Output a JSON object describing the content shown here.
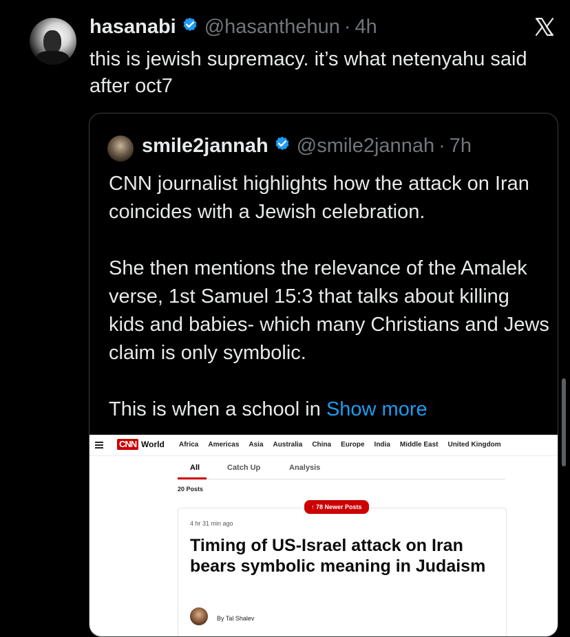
{
  "main_tweet": {
    "display_name": "hasanabi",
    "handle": "@hasanthehun",
    "separator": "·",
    "time": "4h",
    "text": "this is jewish supremacy. it’s what netenyahu said after oct7"
  },
  "quoted_tweet": {
    "display_name": "smile2jannah",
    "handle": "@smile2jannah",
    "separator": "·",
    "time": "7h",
    "paragraph_1": "CNN journalist highlights how the attack on Iran coincides with a Jewish celebration.",
    "paragraph_2": "She then mentions the relevance of the Amalek verse, 1st Samuel 15:3 that talks about killing kids and babies- which many Christians and Jews claim is only symbolic.",
    "paragraph_3": "This is when a school in ",
    "show_more": "Show more"
  },
  "cnn_screenshot": {
    "logo": "CNN",
    "section": "World",
    "nav_links": [
      "Africa",
      "Americas",
      "Asia",
      "Australia",
      "China",
      "Europe",
      "India",
      "Middle East",
      "United Kingdom"
    ],
    "tabs": [
      "All",
      "Catch Up",
      "Analysis"
    ],
    "post_count": "20 Posts",
    "newer_posts": "↑ 78 Newer Posts",
    "post_time": "4 hr 31 min ago",
    "headline": "Timing of US-Israel attack on Iran bears symbolic meaning in Judaism",
    "author": "By Tal Shalev"
  },
  "colors": {
    "background": "#000000",
    "text": "#e7e9ea",
    "secondary_text": "#71767b",
    "link": "#1d9bf0",
    "verified": "#1d9bf0",
    "cnn_red": "#cc0000"
  },
  "icons": {
    "verified": "verified-badge-icon",
    "x_logo": "x-logo-icon",
    "menu": "hamburger-menu-icon"
  }
}
